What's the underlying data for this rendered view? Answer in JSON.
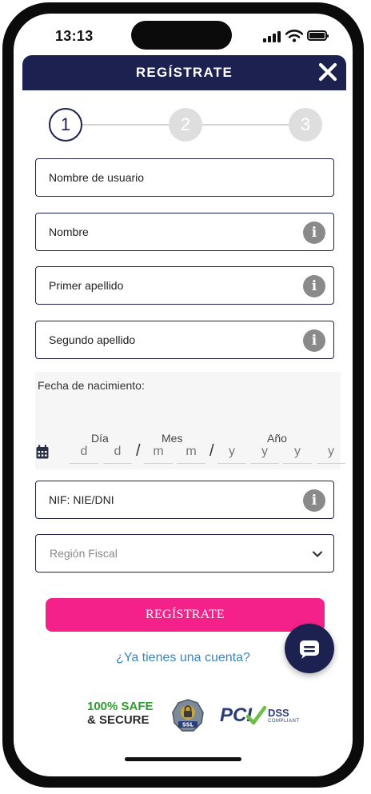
{
  "status_bar": {
    "time": "13:13"
  },
  "header": {
    "title": "REGÍSTRATE"
  },
  "stepper": {
    "steps": [
      "1",
      "2",
      "3"
    ]
  },
  "form": {
    "username": {
      "placeholder": "Nombre de usuario"
    },
    "name": {
      "placeholder": "Nombre"
    },
    "first_surname": {
      "placeholder": "Primer apellido"
    },
    "second_surname": {
      "placeholder": "Segundo apellido"
    },
    "birth_date": {
      "label": "Fecha de nacimiento:",
      "day_label": "Día",
      "month_label": "Mes",
      "year_label": "Año",
      "day_placeholder": "d",
      "month_placeholder": "m",
      "year_placeholder": "y",
      "separator": "/"
    },
    "nif": {
      "placeholder": "NIF: NIE/DNI"
    },
    "fiscal_region": {
      "selected": "Región Fiscal"
    },
    "info_glyph": "i"
  },
  "actions": {
    "register_button": "REGÍSTRATE",
    "login_link": "¿Ya tienes una cuenta?"
  },
  "trust_badges": {
    "safe_line1": "100% SAFE",
    "safe_line2": "& SECURE",
    "ssl": "SSL",
    "pci": "PCI",
    "dss": "DSS",
    "compliant": "COMPLIANT"
  },
  "colors": {
    "brand_navy": "#1c2150",
    "accent_pink": "#f5218a",
    "link_blue": "#3a84b9"
  }
}
